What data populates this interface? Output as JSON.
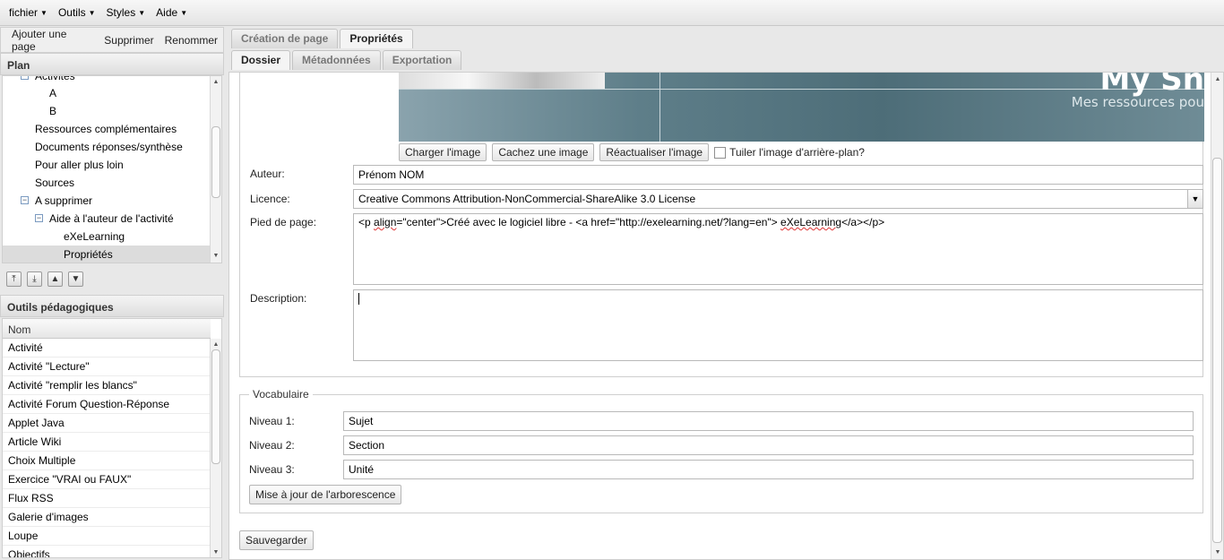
{
  "menubar": {
    "items": [
      {
        "label": "fichier"
      },
      {
        "label": "Outils"
      },
      {
        "label": "Styles"
      },
      {
        "label": "Aide"
      }
    ]
  },
  "left_toolbar": {
    "add": "Ajouter une page",
    "delete": "Supprimer",
    "rename": "Renommer"
  },
  "plan": {
    "title": "Plan",
    "items": [
      {
        "label": "Activités",
        "toggle": "−"
      },
      {
        "label": "A"
      },
      {
        "label": "B"
      },
      {
        "label": "Ressources complémentaires"
      },
      {
        "label": "Documents réponses/synthèse"
      },
      {
        "label": "Pour aller plus loin"
      },
      {
        "label": "Sources"
      },
      {
        "label": "A supprimer",
        "toggle": "−"
      },
      {
        "label": "Aide à l'auteur de l'activité",
        "toggle": "−"
      },
      {
        "label": "eXeLearning"
      },
      {
        "label": "Propriétés"
      }
    ]
  },
  "move_buttons": [
    "⤒",
    "⤓",
    "▲",
    "▼"
  ],
  "outils": {
    "title": "Outils pédagogiques",
    "column": "Nom",
    "items": [
      "Activité",
      "Activité \"Lecture\"",
      "Activité \"remplir les blancs\"",
      "Activité Forum Question-Réponse",
      "Applet Java",
      "Article Wiki",
      "Choix Multiple",
      "Exercice \"VRAI ou FAUX\"",
      "Flux RSS",
      "Galerie d'images",
      "Loupe",
      "Objectifs"
    ]
  },
  "tabs_main": {
    "creation": "Création de page",
    "properties": "Propriétés"
  },
  "tabs_sub": {
    "dossier": "Dossier",
    "meta": "Métadonnées",
    "export": "Exportation"
  },
  "banner": {
    "title": "My Sn",
    "subtitle": "Mes ressources pou"
  },
  "image_buttons": {
    "load": "Charger l'image",
    "hide": "Cachez une image",
    "refresh": "Réactualiser l'image",
    "tile": "Tuiler l'image d'arrière-plan?"
  },
  "form": {
    "author_label": "Auteur:",
    "author_value": "Prénom NOM",
    "license_label": "Licence:",
    "license_value": "Creative Commons Attribution-NonCommercial-ShareAlike 3.0 License",
    "footer_label": "Pied de page:",
    "footer_value_a": "<p ",
    "footer_value_b": "align",
    "footer_value_c": "=\"center\">Créé avec le logiciel libre - <a href=\"http://exelearning.net/?lang=en\"> ",
    "footer_value_d": "eXeLearning",
    "footer_value_e": "</a></p>",
    "description_label": "Description:",
    "description_value": ""
  },
  "vocab": {
    "legend": "Vocabulaire",
    "l1_label": "Niveau 1:",
    "l1_value": "Sujet",
    "l2_label": "Niveau 2:",
    "l2_value": "Section",
    "l3_label": "Niveau 3:",
    "l3_value": "Unité",
    "update": "Mise à jour de l'arborescence"
  },
  "save": "Sauvegarder"
}
